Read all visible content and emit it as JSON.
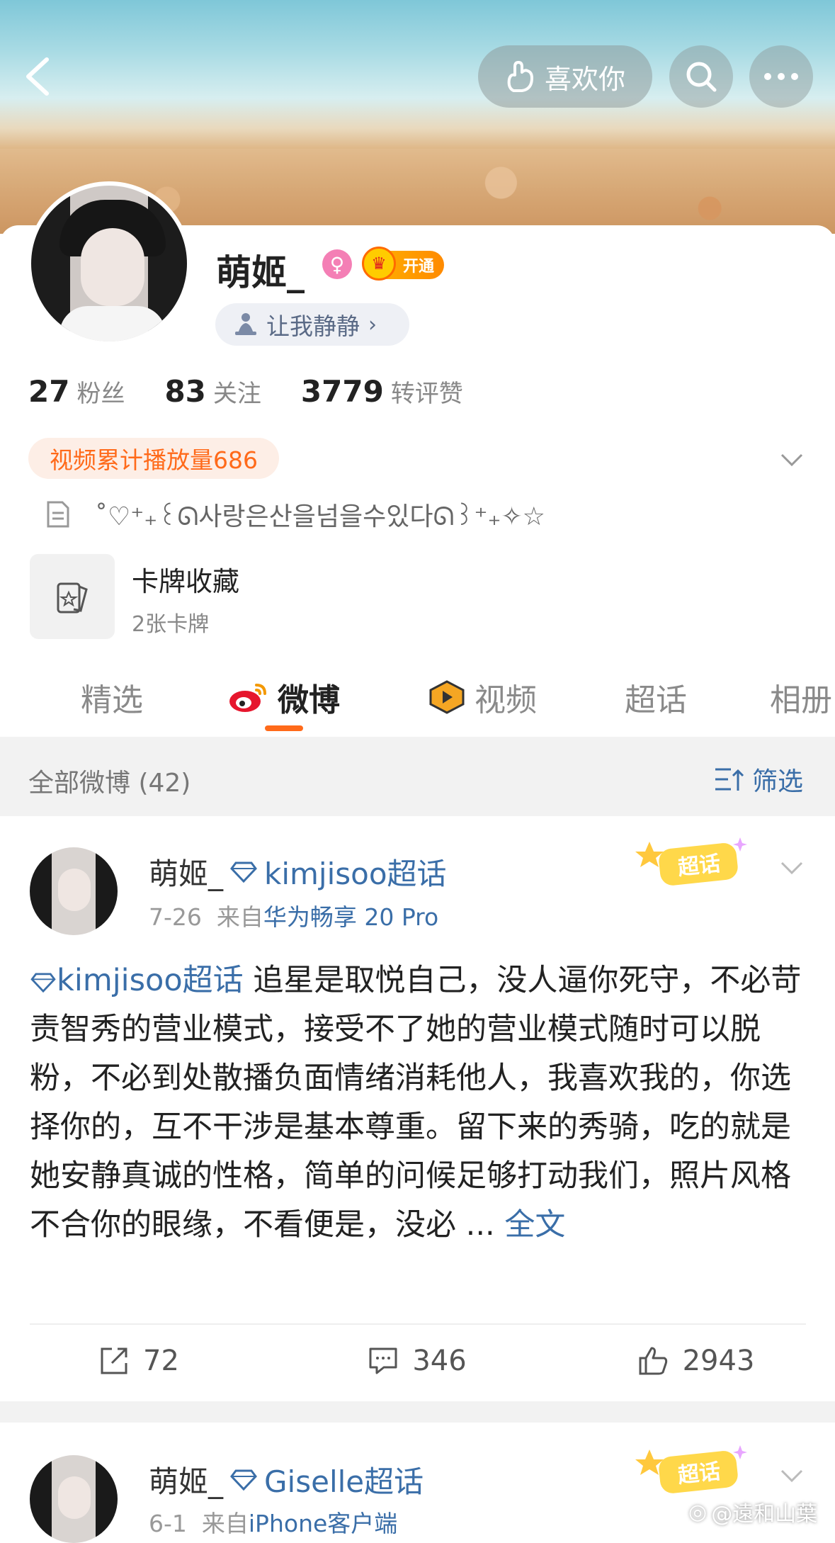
{
  "header": {
    "like_label": "喜欢你",
    "icons": [
      "back-icon",
      "like-hand-icon",
      "search-icon",
      "more-icon"
    ]
  },
  "profile": {
    "name": "萌姬_",
    "vip_label": "开通",
    "status": "让我静静",
    "stats": [
      {
        "num": "27",
        "label": "粉丝"
      },
      {
        "num": "83",
        "label": "关注"
      },
      {
        "num": "3779",
        "label": "转评赞"
      }
    ],
    "video_tag": "视频累计播放量686",
    "bio": "˚♡⁺₊꒰ᘏ사랑은산을넘을수있다ᘏ꒱⁺₊✧☆",
    "card_collection": {
      "title": "卡牌收藏",
      "sub": "2张卡牌"
    }
  },
  "tabs": [
    {
      "label": "精选",
      "active": false
    },
    {
      "label": "微博",
      "active": true
    },
    {
      "label": "视频",
      "active": false
    },
    {
      "label": "超话",
      "active": false
    },
    {
      "label": "相册",
      "active": false
    }
  ],
  "feed": {
    "all_label": "全部微博 (42)",
    "filter_label": "筛选",
    "posts": [
      {
        "name": "萌姬_",
        "topic": "kimjisoo超话",
        "date": "7-26",
        "source_prefix": "来自",
        "source": "华为畅享 20 Pro",
        "badge": "超话",
        "hashtag": "kimjisoo超话",
        "text": " 追星是取悦自己，没人逼你死守，不必苛责智秀的营业模式，接受不了她的营业模式随时可以脱粉，不必到处散播负面情绪消耗他人，我喜欢我的，你选择你的，互不干涉是基本尊重。留下来的秀骑，吃的就是她安静真诚的性格，简单的问候足够打动我们，照片风格不合你的眼缘，不看便是，没必 ... ",
        "full_label": "全文",
        "reposts": "72",
        "comments": "346",
        "likes": "2943"
      },
      {
        "name": "萌姬_",
        "topic": "Giselle超话",
        "date": "6-1",
        "source_prefix": "来自",
        "source": "iPhone客户端",
        "badge": "超话"
      }
    ]
  },
  "watermark": "@遠和山葉"
}
